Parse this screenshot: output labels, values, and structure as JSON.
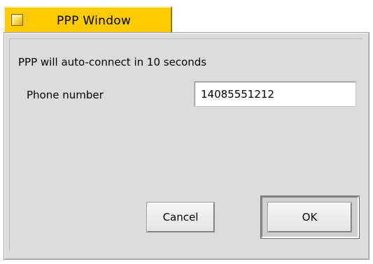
{
  "window": {
    "title": "PPP Window"
  },
  "dialog": {
    "status_message": "PPP will auto-connect in 10 seconds",
    "phone_label": "Phone number",
    "phone_value": "14085551212",
    "cancel_label": "Cancel",
    "ok_label": "OK"
  },
  "colors": {
    "title_tab": "#ffcb00",
    "window_bg": "#dcdcdc",
    "input_bg": "#ffffff"
  },
  "icons": {
    "close": "close-box-icon"
  }
}
